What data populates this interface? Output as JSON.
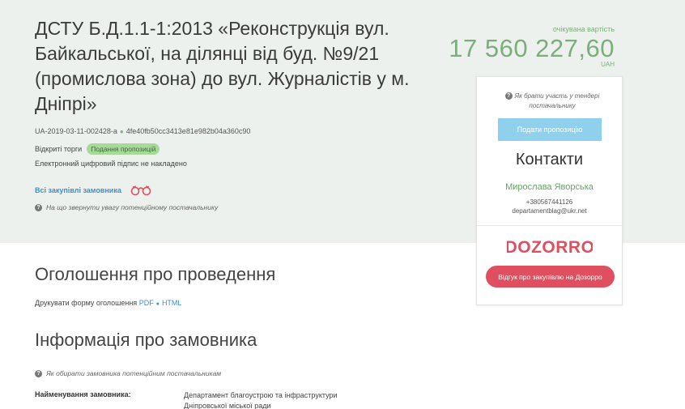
{
  "tender": {
    "title": "ДСТУ Б.Д.1.1-1:2013 «Реконструкція вул. Байкальської, на ділянці від буд. №9/21 (промислова зона) до вул. Журналістів у м. Дніпрі»",
    "id": "UA-2019-03-11-002428-a",
    "hash": "4fe40fb50cc3413e81e982b04a360c90",
    "type": "Відкриті торги",
    "status_badge": "Подання пропозицій",
    "signature_note": "Електронний цифровий підпис не накладено",
    "all_purchases_link": "Всі закупівлі замовника",
    "attention_note": "На що звернути увагу потенційному постачальнику"
  },
  "price": {
    "label": "очікувана вартість",
    "value": "17 560 227,60",
    "currency": "UAH"
  },
  "sidebar": {
    "how_to_participate": "Як брати участь у тендері постачальнику",
    "submit_button": "Подати пропозицію",
    "contacts_title": "Контакти",
    "contact_name": "Мирослава Яворська",
    "contact_phone": "+380567441126",
    "contact_email": "departamentblag@ukr.net",
    "dozorro_logo": "DOZORRO",
    "dozorro_button": "Відгук про закупівлю на Дозорро"
  },
  "announcement": {
    "title": "Оголошення про проведення",
    "print_text": "Друкувати форму оголошення",
    "pdf_link": "PDF",
    "html_link": "HTML"
  },
  "customer": {
    "title": "Інформація про замовника",
    "how_to_choose": "Як обирати замовника потенційним постачальникам",
    "name_label": "Найменування замовника:",
    "name_value": "Департамент благоустрою та інфраструктури Дніпровської міської ради"
  },
  "colors": {
    "hero_bg": "#edf1ee",
    "price_green": "#7cae7c",
    "badge_bg": "#a6d99a",
    "link_blue": "#3d8fc7",
    "submit_btn": "#8fd0ec",
    "dozorro_red": "#e04f5f"
  }
}
